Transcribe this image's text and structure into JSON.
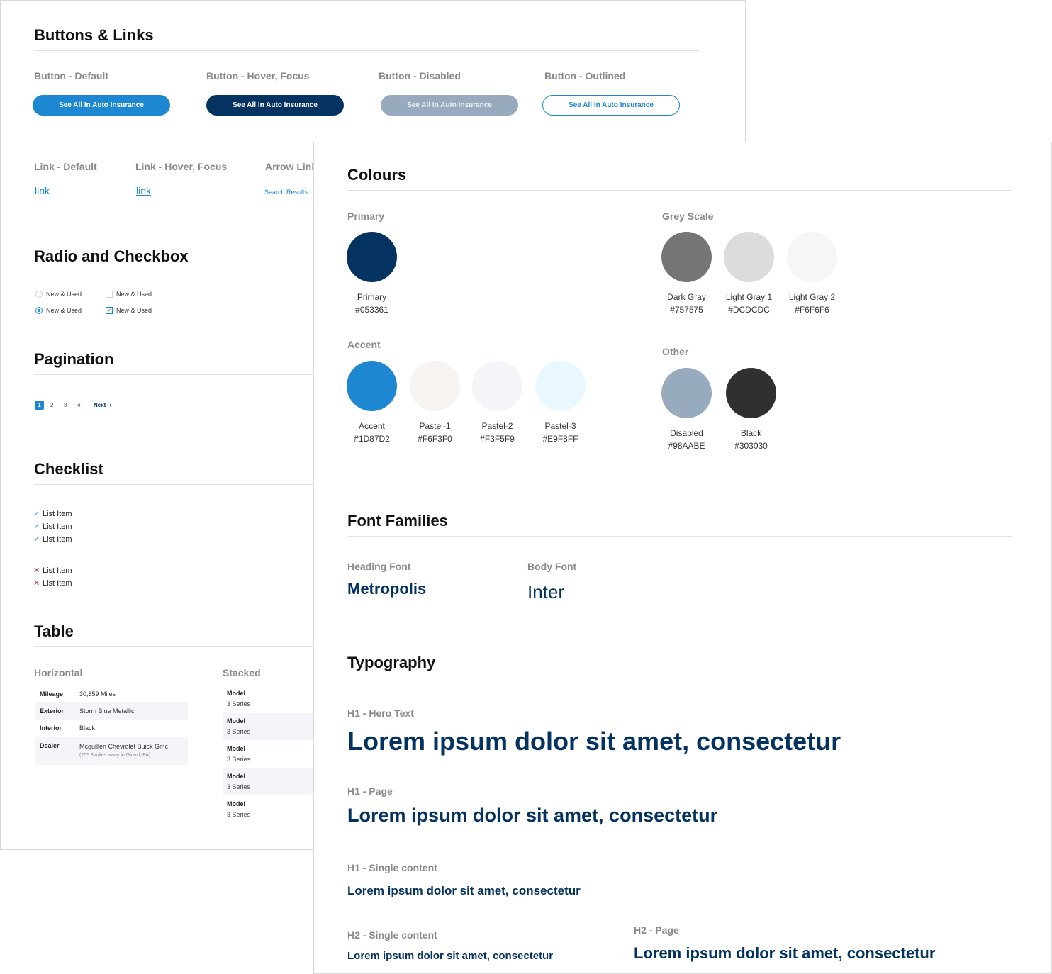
{
  "buttons_links": {
    "title": "Buttons & Links",
    "button_labels": [
      "Button - Default",
      "Button - Hover, Focus",
      "Button - Disabled",
      "Button - Outlined"
    ],
    "button_text": "See All In Auto Insurance",
    "link_labels": [
      "Link - Default",
      "Link - Hover, Focus",
      "Arrow Link"
    ],
    "link_text": "link",
    "arrow_link_text": "Search Results"
  },
  "radio_checkbox": {
    "title": "Radio and Checkbox",
    "option_label": "New & Used"
  },
  "pagination": {
    "title": "Pagination",
    "pages": [
      "1",
      "2",
      "3",
      "4"
    ],
    "current": "1",
    "next": "Next",
    "next_arrow": "›"
  },
  "checklist": {
    "title": "Checklist",
    "item_label": "List Item",
    "positive_mark": "✓",
    "negative_mark": "✕"
  },
  "table": {
    "title": "Table",
    "horizontal_label": "Horizontal",
    "stacked_label": "Stacked",
    "horizontal_rows": [
      {
        "key": "Mileage",
        "value": "30,859 Miles"
      },
      {
        "key": "Exterior",
        "value": "Storm Blue Metallic"
      },
      {
        "key": "Interior",
        "value": "Black"
      },
      {
        "key": "Dealer",
        "value": "Mcquillen Chevrolet Buick Gmc",
        "sub": "(205.3 miles away in Girard, PA)"
      }
    ],
    "stacked_rows": [
      {
        "key": "Model",
        "value": "3 Series"
      },
      {
        "key": "Model",
        "value": "3 Series"
      },
      {
        "key": "Model",
        "value": "3 Series"
      },
      {
        "key": "Model",
        "value": "3 Series"
      },
      {
        "key": "Model",
        "value": "3 Series"
      }
    ]
  },
  "colours": {
    "title": "Colours",
    "primary_label": "Primary",
    "greyscale_label": "Grey Scale",
    "accent_label": "Accent",
    "other_label": "Other",
    "primary": [
      {
        "name": "Primary",
        "hex": "#053361"
      }
    ],
    "greyscale": [
      {
        "name": "Dark Gray",
        "hex": "#757575"
      },
      {
        "name": "Light Gray 1",
        "hex": "#DCDCDC"
      },
      {
        "name": "Light Gray 2",
        "hex": "#F6F6F6"
      }
    ],
    "accent": [
      {
        "name": "Accent",
        "hex": "#1D87D2"
      },
      {
        "name": "Pastel-1",
        "hex": "#F6F3F0"
      },
      {
        "name": "Pastel-2",
        "hex": "#F3F5F9"
      },
      {
        "name": "Pastel-3",
        "hex": "#E9F8FF"
      }
    ],
    "other": [
      {
        "name": "Disabled",
        "hex": "#98AABE"
      },
      {
        "name": "Black",
        "hex": "#303030"
      }
    ]
  },
  "font_families": {
    "title": "Font Families",
    "heading_label": "Heading Font",
    "heading_font": "Metropolis",
    "body_label": "Body Font",
    "body_font": "Inter"
  },
  "typography": {
    "title": "Typography",
    "samples": [
      {
        "label": "H1 - Hero Text",
        "text": "Lorem ipsum dolor sit amet, consectetur"
      },
      {
        "label": "H1 - Page",
        "text": "Lorem ipsum dolor sit amet, consectetur"
      },
      {
        "label": "H1 - Single content",
        "text": "Lorem ipsum dolor sit amet, consectetur"
      },
      {
        "label": "H2 -  Single content",
        "text": "Lorem ipsum dolor sit amet, consectetur"
      },
      {
        "label": "H2 - Page",
        "text": "Lorem ipsum dolor sit amet, consectetur"
      }
    ]
  }
}
